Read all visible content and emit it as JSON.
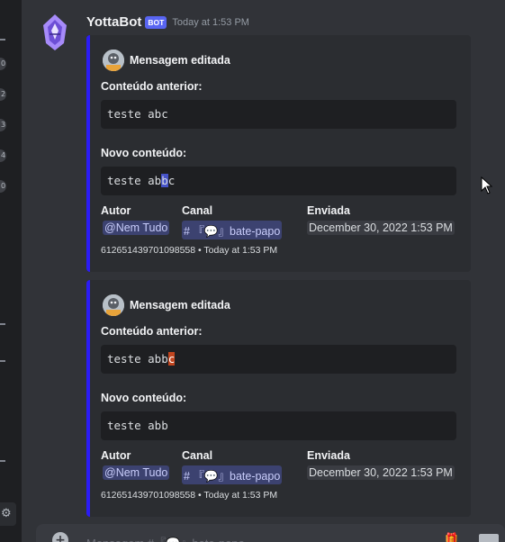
{
  "message": {
    "author": "YottaBot",
    "bot_tag": "BOT",
    "timestamp": "Today at 1:53 PM"
  },
  "embeds": [
    {
      "title": "Mensagem editada",
      "old_label": "Conteúdo anterior:",
      "old_parts": [
        "teste abc",
        "",
        ""
      ],
      "new_label": "Novo conteúdo:",
      "new_parts": [
        "teste ab",
        "b",
        "c"
      ],
      "author_label": "Autor",
      "author_value": "@Nem Tudo",
      "channel_label": "Canal",
      "channel_value": "# 『💬』bate-papo",
      "sent_label": "Enviada",
      "sent_value": "December 30, 2022 1:53 PM",
      "footer": "612651439701098558 • Today at 1:53 PM"
    },
    {
      "title": "Mensagem editada",
      "old_label": "Conteúdo anterior:",
      "old_parts": [
        "teste abb",
        "c",
        ""
      ],
      "new_label": "Novo conteúdo:",
      "new_parts": [
        "teste abb",
        "",
        ""
      ],
      "author_label": "Autor",
      "author_value": "@Nem Tudo",
      "channel_label": "Canal",
      "channel_value": "# 『💬』bate-papo",
      "sent_label": "Enviada",
      "sent_value": "December 30, 2022 1:53 PM",
      "footer": "612651439701098558 • Today at 1:53 PM"
    }
  ],
  "composer": {
    "placeholder": "Mensagem #『💬』bate-papo"
  },
  "sidebar": {
    "pips": [
      "0",
      "2",
      "3",
      "4",
      "0"
    ]
  },
  "colors": {
    "embed_bar": "#2b1cf5",
    "bot_tag": "#5865f2",
    "highlight_added": "#4653c8",
    "highlight_removed": "#c0451f"
  },
  "icons": {
    "bot_avatar": "yottabot-avatar-icon",
    "embed_author": "user-avatar-icon",
    "settings": "gear-icon",
    "add": "plus-circle-icon",
    "gift": "gift-icon",
    "gif": "gif-icon",
    "cursor": "mouse-pointer-icon"
  }
}
